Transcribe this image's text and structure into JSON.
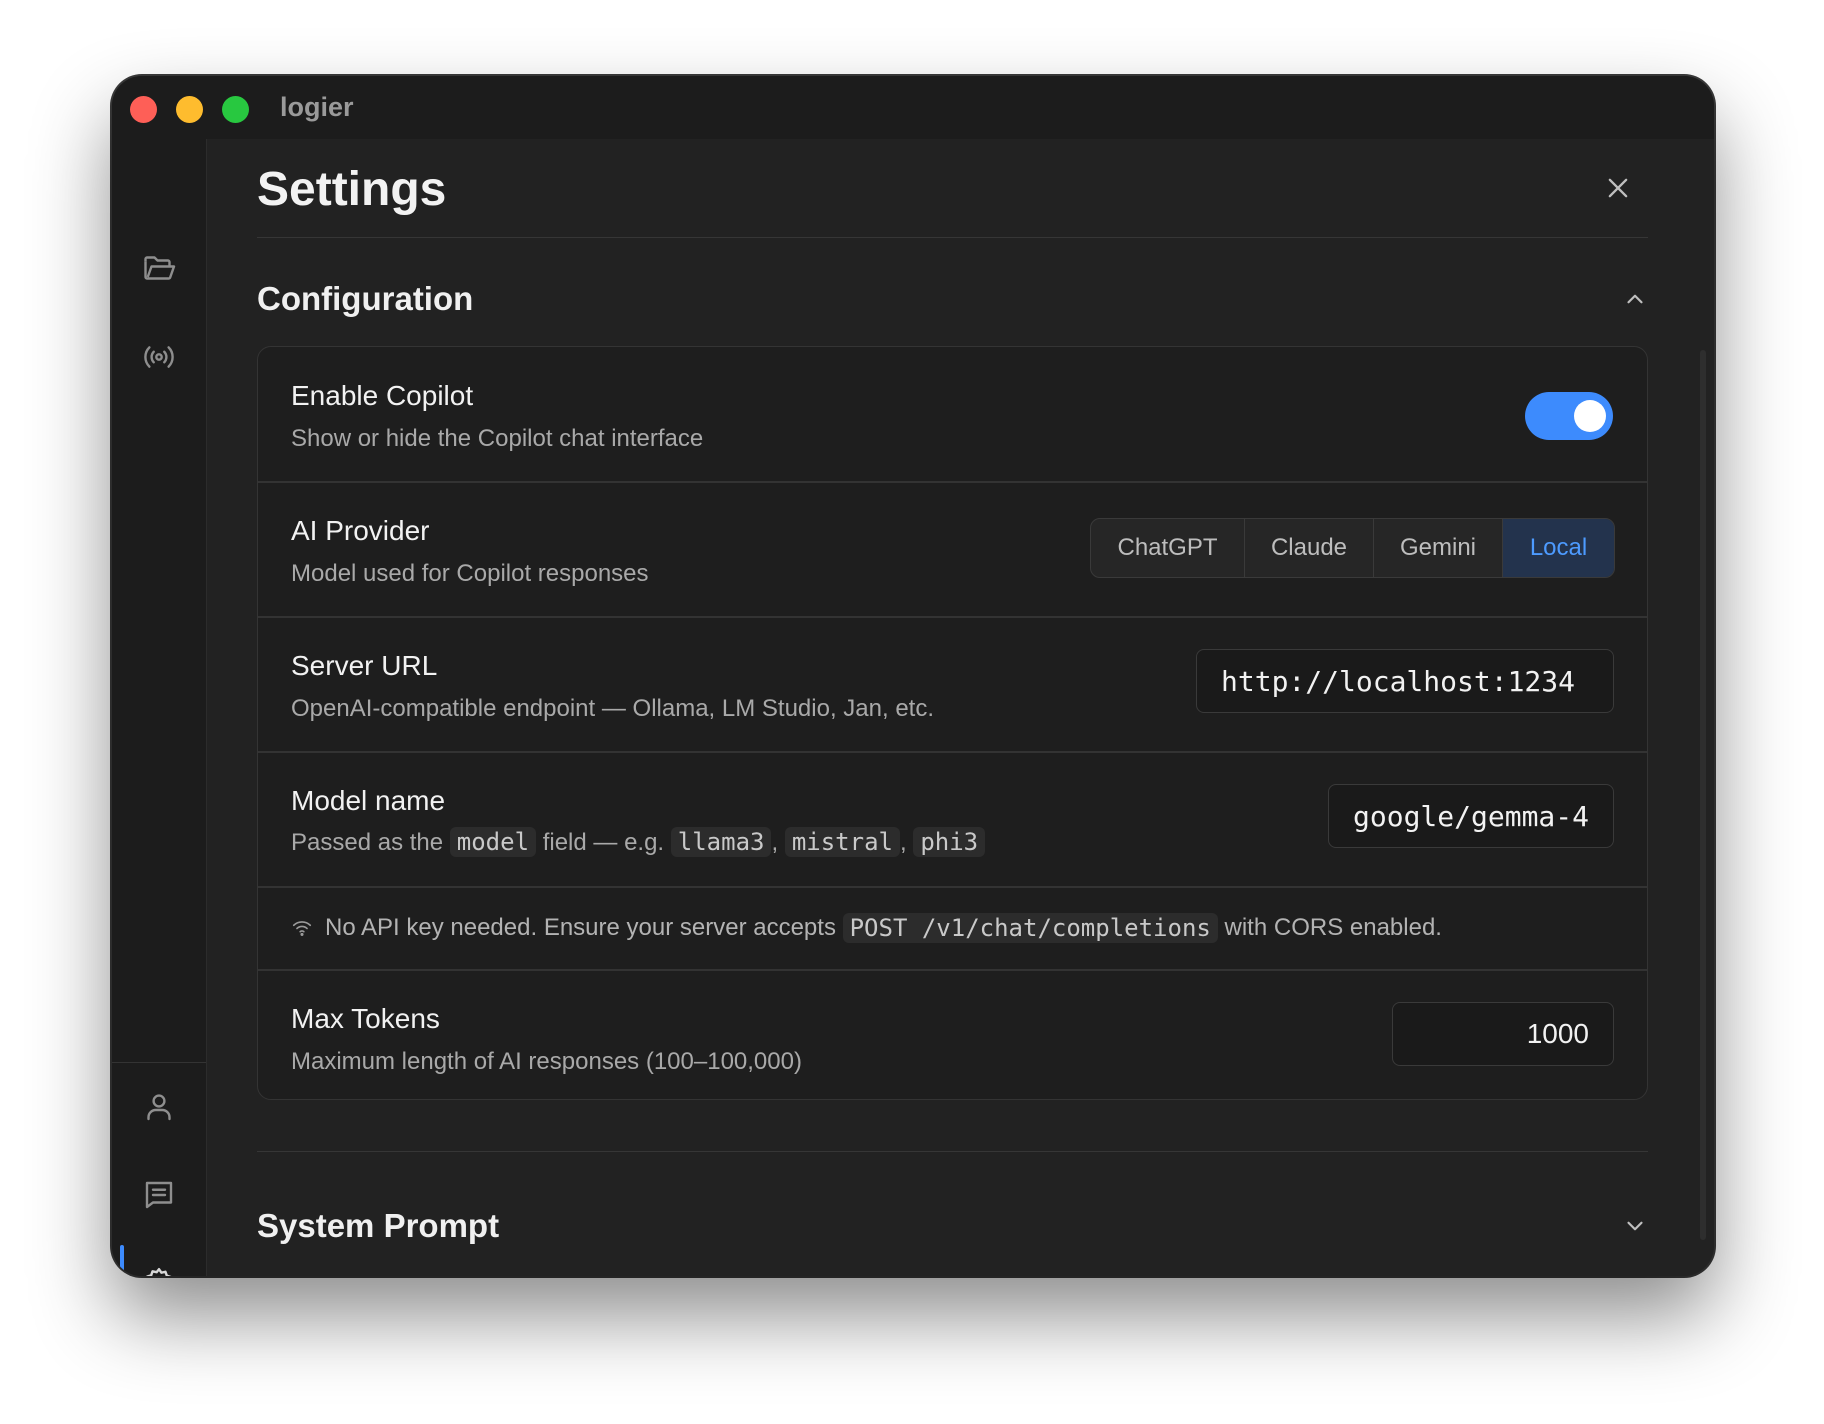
{
  "app": {
    "title": "logier"
  },
  "page": {
    "title": "Settings"
  },
  "sections": {
    "configuration": {
      "title": "Configuration",
      "expanded": true
    },
    "system_prompt": {
      "title": "System Prompt",
      "expanded": false
    }
  },
  "settings": {
    "copilot": {
      "label": "Enable Copilot",
      "description": "Show or hide the Copilot chat interface",
      "enabled": true
    },
    "provider": {
      "label": "AI Provider",
      "description": "Model used for Copilot responses",
      "options": [
        "ChatGPT",
        "Claude",
        "Gemini",
        "Local"
      ],
      "selected": "Local"
    },
    "server_url": {
      "label": "Server URL",
      "description": "OpenAI-compatible endpoint — Ollama, LM Studio, Jan, etc.",
      "value": "http://localhost:1234"
    },
    "model_name": {
      "label": "Model name",
      "desc_prefix": "Passed as the",
      "desc_code_field": "model",
      "desc_middle": "field — e.g.",
      "examples": [
        "llama3",
        "mistral",
        "phi3"
      ],
      "value": "google/gemma-4"
    },
    "local_note": {
      "prefix": "No API key needed. Ensure your server accepts",
      "code": "POST /v1/chat/completions",
      "suffix": "with CORS enabled."
    },
    "max_tokens": {
      "label": "Max Tokens",
      "description": "Maximum length of AI responses (100–100,000)",
      "value": "1000"
    }
  },
  "icons": {
    "sidebar_top": [
      "folder-icon",
      "broadcast-icon"
    ],
    "sidebar_bottom": [
      "user-icon",
      "message-icon",
      "gear-icon"
    ],
    "accent": "#3d8bfd"
  }
}
